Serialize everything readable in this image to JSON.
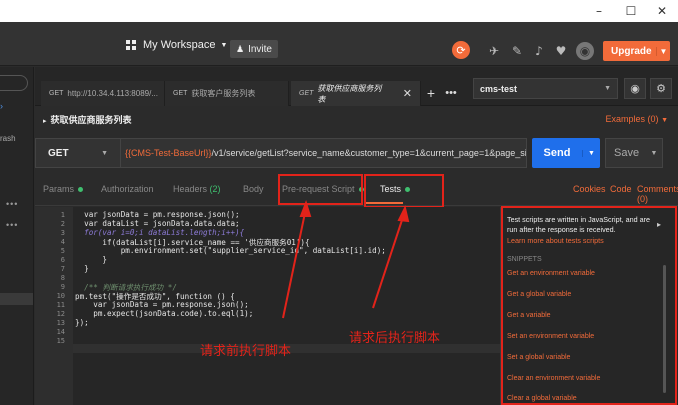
{
  "window": {
    "minimize": "–",
    "maximize": "☐",
    "close": "✕"
  },
  "header": {
    "workspace": "My Workspace",
    "invite": "Invite",
    "upgrade": "Upgrade"
  },
  "sidebar": {
    "fragment": "rash"
  },
  "tabs": [
    {
      "method": "GET",
      "label": "http://10.34.4.113:8089/..."
    },
    {
      "method": "GET",
      "label": "获取客户服务列表"
    },
    {
      "method": "GET",
      "label": "获取供应商服务列表"
    }
  ],
  "environment": {
    "selected": "cms-test"
  },
  "request": {
    "name": "获取供应商服务列表",
    "examples": "Examples (0)",
    "method": "GET",
    "url_var": "{{CMS-Test-BaseUrl}}",
    "url_rest": "/v1/service/getList?service_name&customer_type=1&current_page=1&page_siz...",
    "send": "Send",
    "save": "Save"
  },
  "subtabs": {
    "params": "Params",
    "authorization": "Authorization",
    "headers": "Headers",
    "headers_count": "(2)",
    "body": "Body",
    "prerequest": "Pre-request Script",
    "tests": "Tests",
    "cookies": "Cookies",
    "code": "Code",
    "comments": "Comments (0)"
  },
  "editor": {
    "line_numbers": [
      "1",
      "2",
      "3",
      "4",
      "5",
      "6",
      "7",
      "8",
      "9",
      "10",
      "11",
      "12",
      "13",
      "14",
      "15"
    ],
    "lines": [
      "  var jsonData = pm.response.json();",
      "  var dataList = jsonData.data.data;",
      "  for(var i=0;i dataList.length;i++){",
      "      if(dataList[i].service_name == '供应商服务01'){",
      "          pm.environment.set(\"supplier_service_id\", dataList[i].id);",
      "      }",
      "  }",
      "",
      "  /** 判断请求执行成功 */",
      "pm.test(\"操作是否成功\", function () {",
      "    var jsonData = pm.response.json();",
      "    pm.expect(jsonData.code).to.eql(1);",
      "});",
      "",
      ""
    ]
  },
  "snippets": {
    "description": "Test scripts are written in JavaScript, and are run after the response is received.",
    "learn_more": "Learn more about tests scripts",
    "heading": "SNIPPETS",
    "items": [
      "Get an environment variable",
      "Get a global variable",
      "Get a variable",
      "Set an environment variable",
      "Set a global variable",
      "Clear an environment variable",
      "Clear a global variable"
    ]
  },
  "annotations": {
    "before": "请求前执行脚本",
    "after": "请求后执行脚本"
  },
  "colors": {
    "accent": "#f26b3a",
    "send": "#1f6feb",
    "annotation": "#e2231a"
  }
}
